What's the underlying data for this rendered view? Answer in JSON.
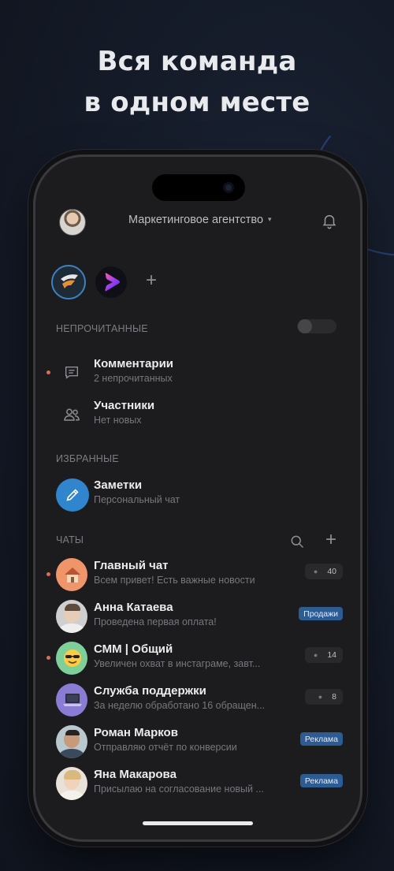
{
  "headline": {
    "line1": "Вся команда",
    "line2": "в одном месте"
  },
  "topbar": {
    "workspace_name": "Маркетинговое агентство",
    "caret": "▾"
  },
  "spaces": {
    "add_label": "+"
  },
  "unread": {
    "section_label": "НЕПРОЧИТАННЫЕ",
    "items": [
      {
        "title": "Комментарии",
        "subtitle": "2 непрочитанных",
        "unread": true,
        "icon": "comment-icon"
      },
      {
        "title": "Участники",
        "subtitle": "Нет новых",
        "unread": false,
        "icon": "users-icon"
      }
    ]
  },
  "favorites": {
    "section_label": "ИЗБРАННЫЕ",
    "items": [
      {
        "title": "Заметки",
        "subtitle": "Персональный чат",
        "icon": "pencil-icon",
        "color": "#2f86cf"
      }
    ]
  },
  "chats": {
    "section_label": "ЧАТЫ",
    "add_label": "+",
    "items": [
      {
        "title": "Главный чат",
        "subtitle": "Всем привет! Есть важные новости",
        "unread": true,
        "count": "40",
        "avatar": "house-icon",
        "avatar_bg": "#f0946a"
      },
      {
        "title": "Анна Катаева",
        "subtitle": "Проведена первая оплата!",
        "unread": false,
        "tag": "Продажи",
        "avatar": "photo-woman",
        "avatar_bg": "#cfcfcf"
      },
      {
        "title": "СММ | Общий",
        "subtitle": "Увеличен охват в инстаграме, завт...",
        "unread": true,
        "count": "14",
        "avatar": "cool-emoji-icon",
        "avatar_bg": "#7ed09a"
      },
      {
        "title": "Служба поддержки",
        "subtitle": "За неделю обработано 16 обращен...",
        "unread": false,
        "count": "8",
        "avatar": "laptop-icon",
        "avatar_bg": "#8a7cd4"
      },
      {
        "title": "Роман Марков",
        "subtitle": "Отправляю отчёт по конверсии",
        "unread": false,
        "tag": "Реклама",
        "avatar": "photo-man",
        "avatar_bg": "#b9c8cf"
      },
      {
        "title": "Яна Макарова",
        "subtitle": "Присылаю на согласование новый ...",
        "unread": false,
        "tag": "Реклама",
        "avatar": "photo-woman-blonde",
        "avatar_bg": "#e8e2da"
      }
    ]
  },
  "colors": {
    "accent": "#3b82c4",
    "unread_dot": "#e06a5c",
    "tag_bg": "#2d5b93"
  }
}
